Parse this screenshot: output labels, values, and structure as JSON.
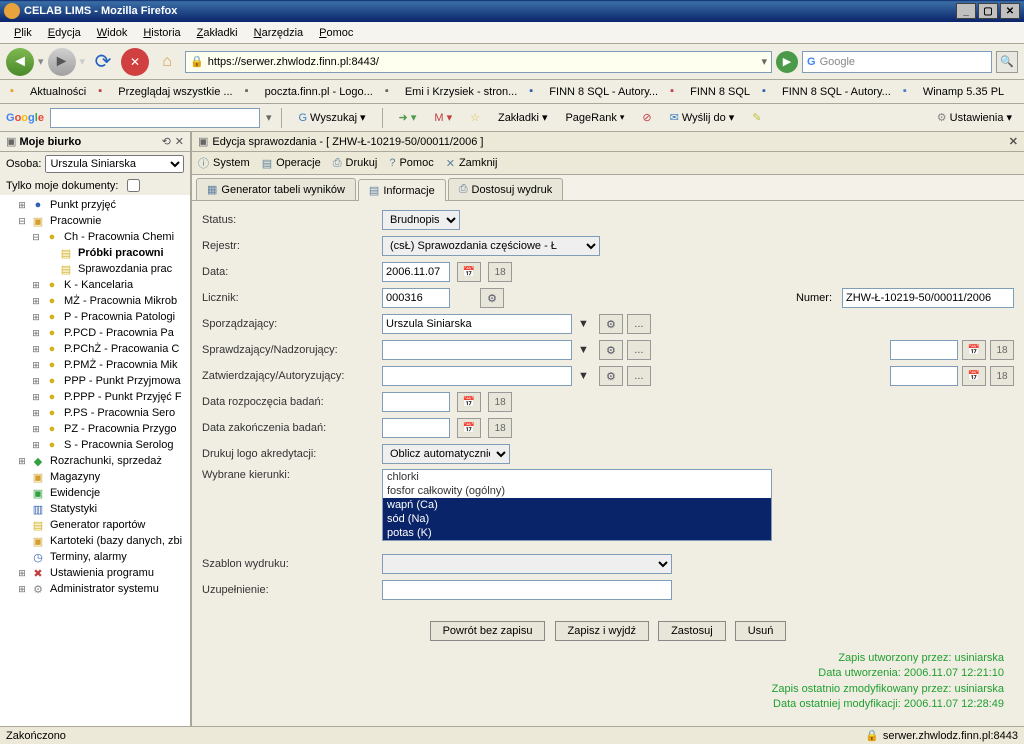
{
  "window": {
    "title": "CELAB LIMS - Mozilla Firefox"
  },
  "menubar": [
    "Plik",
    "Edycja",
    "Widok",
    "Historia",
    "Zakładki",
    "Narzędzia",
    "Pomoc"
  ],
  "navbar": {
    "url": "https://serwer.zhwlodz.finn.pl:8443/",
    "search_placeholder": "Google"
  },
  "bookmarks": [
    {
      "label": "Aktualności",
      "color": "#e8a020"
    },
    {
      "label": "Przeglądaj wszystkie ...",
      "color": "#c04040"
    },
    {
      "label": "poczta.finn.pl - Logo...",
      "color": "#666"
    },
    {
      "label": "Emi i Krzysiek - stron...",
      "color": "#666"
    },
    {
      "label": "FINN 8 SQL - Autory...",
      "color": "#3060b0"
    },
    {
      "label": "FINN 8 SQL",
      "color": "#c04040"
    },
    {
      "label": "FINN 8 SQL - Autory...",
      "color": "#3060b0"
    },
    {
      "label": "Winamp 5.35 PL",
      "color": "#4080c0"
    }
  ],
  "gbar": {
    "wyszukaj": "Wyszukaj",
    "zakladki": "Zakładki",
    "pagerank": "PageRank",
    "wyslij": "Wyślij do",
    "ustawienia": "Ustawienia"
  },
  "sidebar": {
    "title": "Moje biurko",
    "osoba_label": "Osoba:",
    "osoba": "Urszula Siniarska",
    "tylko": "Tylko moje dokumenty:",
    "tree": [
      {
        "l": "Punkt przyjęć",
        "ind": 1,
        "exp": "+",
        "ic": "●",
        "c": "ic-blue"
      },
      {
        "l": "Pracownie",
        "ind": 1,
        "exp": "−",
        "ic": "▣",
        "c": "ic-folder"
      },
      {
        "l": "Ch - Pracownia Chemi",
        "ind": 2,
        "exp": "−",
        "ic": "●",
        "c": "ic-yellow"
      },
      {
        "l": "Próbki pracowni",
        "ind": 3,
        "exp": "",
        "ic": "▤",
        "c": "ic-yellow",
        "bold": true
      },
      {
        "l": "Sprawozdania prac",
        "ind": 3,
        "exp": "",
        "ic": "▤",
        "c": "ic-yellow"
      },
      {
        "l": "K - Kancelaria",
        "ind": 2,
        "exp": "+",
        "ic": "●",
        "c": "ic-yellow"
      },
      {
        "l": "MŻ - Pracownia Mikrob",
        "ind": 2,
        "exp": "+",
        "ic": "●",
        "c": "ic-yellow"
      },
      {
        "l": "P - Pracownia Patologi",
        "ind": 2,
        "exp": "+",
        "ic": "●",
        "c": "ic-yellow"
      },
      {
        "l": "P.PCD - Pracownia Pa",
        "ind": 2,
        "exp": "+",
        "ic": "●",
        "c": "ic-yellow"
      },
      {
        "l": "P.PChŻ - Pracowania C",
        "ind": 2,
        "exp": "+",
        "ic": "●",
        "c": "ic-yellow"
      },
      {
        "l": "P.PMŻ - Pracownia Mik",
        "ind": 2,
        "exp": "+",
        "ic": "●",
        "c": "ic-yellow"
      },
      {
        "l": "PPP - Punkt Przyjmowa",
        "ind": 2,
        "exp": "+",
        "ic": "●",
        "c": "ic-yellow"
      },
      {
        "l": "P.PPP - Punkt Przyjęć F",
        "ind": 2,
        "exp": "+",
        "ic": "●",
        "c": "ic-yellow"
      },
      {
        "l": "P.PS - Pracownia Sero",
        "ind": 2,
        "exp": "+",
        "ic": "●",
        "c": "ic-yellow"
      },
      {
        "l": "PZ - Pracownia Przygo",
        "ind": 2,
        "exp": "+",
        "ic": "●",
        "c": "ic-yellow"
      },
      {
        "l": "S - Pracownia Serolog",
        "ind": 2,
        "exp": "+",
        "ic": "●",
        "c": "ic-yellow"
      },
      {
        "l": "Rozrachunki, sprzedaż",
        "ind": 1,
        "exp": "+",
        "ic": "◆",
        "c": "ic-green"
      },
      {
        "l": "Magazyny",
        "ind": 1,
        "exp": "",
        "ic": "▣",
        "c": "ic-folder"
      },
      {
        "l": "Ewidencje",
        "ind": 1,
        "exp": "",
        "ic": "▣",
        "c": "ic-green"
      },
      {
        "l": "Statystyki",
        "ind": 1,
        "exp": "",
        "ic": "▥",
        "c": "ic-blue"
      },
      {
        "l": "Generator raportów",
        "ind": 1,
        "exp": "",
        "ic": "▤",
        "c": "ic-yellow"
      },
      {
        "l": "Kartoteki (bazy danych, zbi",
        "ind": 1,
        "exp": "",
        "ic": "▣",
        "c": "ic-folder"
      },
      {
        "l": "Terminy, alarmy",
        "ind": 1,
        "exp": "",
        "ic": "◷",
        "c": "ic-blue"
      },
      {
        "l": "Ustawienia programu",
        "ind": 1,
        "exp": "+",
        "ic": "✖",
        "c": "ic-red"
      },
      {
        "l": "Administrator systemu",
        "ind": 1,
        "exp": "+",
        "ic": "⚙",
        "c": "ic-gear"
      }
    ]
  },
  "content": {
    "title": "Edycja sprawozdania - [ ZHW-Ł-10219-50/00011/2006 ]",
    "menu": [
      {
        "label": "System",
        "icon": "ⓘ"
      },
      {
        "label": "Operacje",
        "icon": "▤"
      },
      {
        "label": "Drukuj",
        "icon": "⎙"
      },
      {
        "label": "Pomoc",
        "icon": "?"
      },
      {
        "label": "Zamknij",
        "icon": "✕"
      }
    ],
    "tabs": [
      {
        "label": "Generator tabeli wyników",
        "active": false,
        "icon": "▦"
      },
      {
        "label": "Informacje",
        "active": true,
        "icon": "▤"
      },
      {
        "label": "Dostosuj wydruk",
        "active": false,
        "icon": "⎙"
      }
    ],
    "form": {
      "status_label": "Status:",
      "status": "Brudnopis",
      "rejestr_label": "Rejestr:",
      "rejestr": "(csŁ) Sprawozdania częściowe - Ł",
      "data_label": "Data:",
      "data": "2006.11.07",
      "licznik_label": "Licznik:",
      "licznik": "000316",
      "numer_label": "Numer:",
      "numer": "ZHW-Ł-10219-50/00011/2006",
      "sporz_label": "Sporządzający:",
      "sporz": "Urszula Siniarska",
      "sprawdz_label": "Sprawdzający/Nadzorujący:",
      "zatw_label": "Zatwierdzający/Autoryzujący:",
      "data_rozp_label": "Data rozpoczęcia badań:",
      "data_zak_label": "Data zakończenia badań:",
      "logo_label": "Drukuj logo akredytacji:",
      "logo": "Oblicz automatycznie",
      "kier_label": "Wybrane kierunki:",
      "kierunki": [
        {
          "t": "chlorki",
          "s": false
        },
        {
          "t": "fosfor całkowity (ogólny)",
          "s": false
        },
        {
          "t": "wapń (Ca)",
          "s": true
        },
        {
          "t": "sód (Na)",
          "s": true
        },
        {
          "t": "potas (K)",
          "s": true
        }
      ],
      "szablon_label": "Szablon wydruku:",
      "uzup_label": "Uzupełnienie:"
    },
    "buttons": {
      "powrot": "Powrót bez zapisu",
      "zapisz": "Zapisz i wyjdź",
      "zastosuj": "Zastosuj",
      "usun": "Usuń"
    },
    "meta": [
      "Zapis utworzony przez: usiniarska",
      "Data utworzenia: 2006.11.07 12:21:10",
      "Zapis ostatnio zmodyfikowany przez: usiniarska",
      "Data ostatniej modyfikacji: 2006.11.07 12:28:49"
    ]
  },
  "statusbar": {
    "left": "Zakończono",
    "right": "serwer.zhwlodz.finn.pl:8443"
  }
}
